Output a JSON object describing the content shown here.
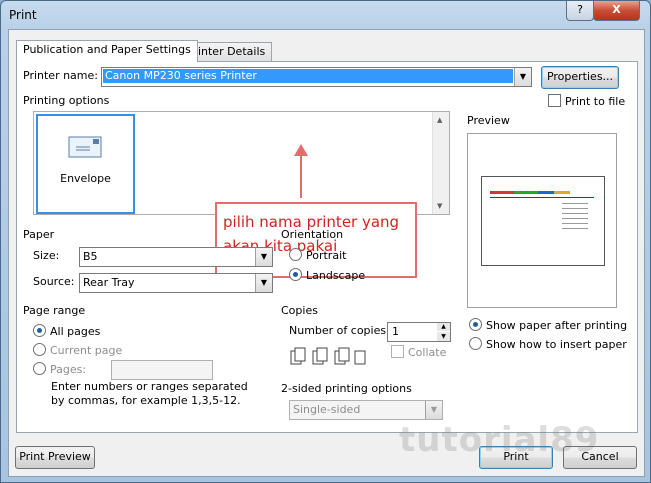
{
  "window": {
    "title": "Print",
    "help": "?",
    "close": "X"
  },
  "tabs": [
    {
      "label": "Publication and Paper Settings"
    },
    {
      "label": "Printer Details"
    }
  ],
  "printer": {
    "label": "Printer name:",
    "value": "Canon MP230 series Printer",
    "properties": "Properties...",
    "print_to_file": "Print to file"
  },
  "printing_options": {
    "label": "Printing options",
    "tile": "Envelope"
  },
  "annotation": {
    "text": "pilih nama printer yang akan kita pakai"
  },
  "preview": {
    "label": "Preview"
  },
  "paper": {
    "label": "Paper",
    "size_label": "Size:",
    "size_value": "B5",
    "source_label": "Source:",
    "source_value": "Rear Tray"
  },
  "orientation": {
    "label": "Orientation",
    "portrait": "Portrait",
    "landscape": "Landscape"
  },
  "page_range": {
    "label": "Page range",
    "all": "All pages",
    "current": "Current page",
    "pages": "Pages:",
    "hint": "Enter numbers or ranges separated by commas, for example 1,3,5-12."
  },
  "copies": {
    "label": "Copies",
    "number_label": "Number of copies:",
    "number_value": "1",
    "collate": "Collate"
  },
  "two_sided": {
    "label": "2-sided printing options",
    "value": "Single-sided"
  },
  "after": {
    "show_paper": "Show paper after printing",
    "show_insert": "Show how to insert paper"
  },
  "footer": {
    "print_preview": "Print Preview",
    "print": "Print",
    "cancel": "Cancel"
  },
  "watermark": "tutorial89"
}
